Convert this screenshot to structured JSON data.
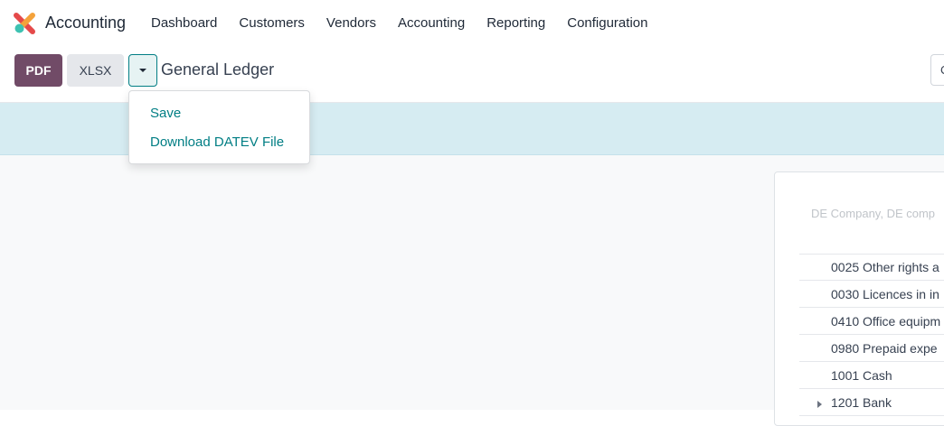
{
  "navbar": {
    "app_name": "Accounting",
    "menu": [
      "Dashboard",
      "Customers",
      "Vendors",
      "Accounting",
      "Reporting",
      "Configuration"
    ]
  },
  "control": {
    "pdf_label": "PDF",
    "xlsx_label": "XLSX",
    "title": "General Ledger",
    "search_partial": "C"
  },
  "dropdown": {
    "items": [
      "Save",
      "Download DATEV File"
    ]
  },
  "report": {
    "company": "DE Company, DE comp",
    "rows": [
      "0025 Other rights a",
      "0030 Licences in in",
      "0410 Office equipm",
      "0980 Prepaid expe",
      "1001 Cash",
      "1201 Bank"
    ]
  },
  "colors": {
    "brand": "#714b67",
    "accent": "#017e84",
    "banner": "#d6ecf2"
  }
}
